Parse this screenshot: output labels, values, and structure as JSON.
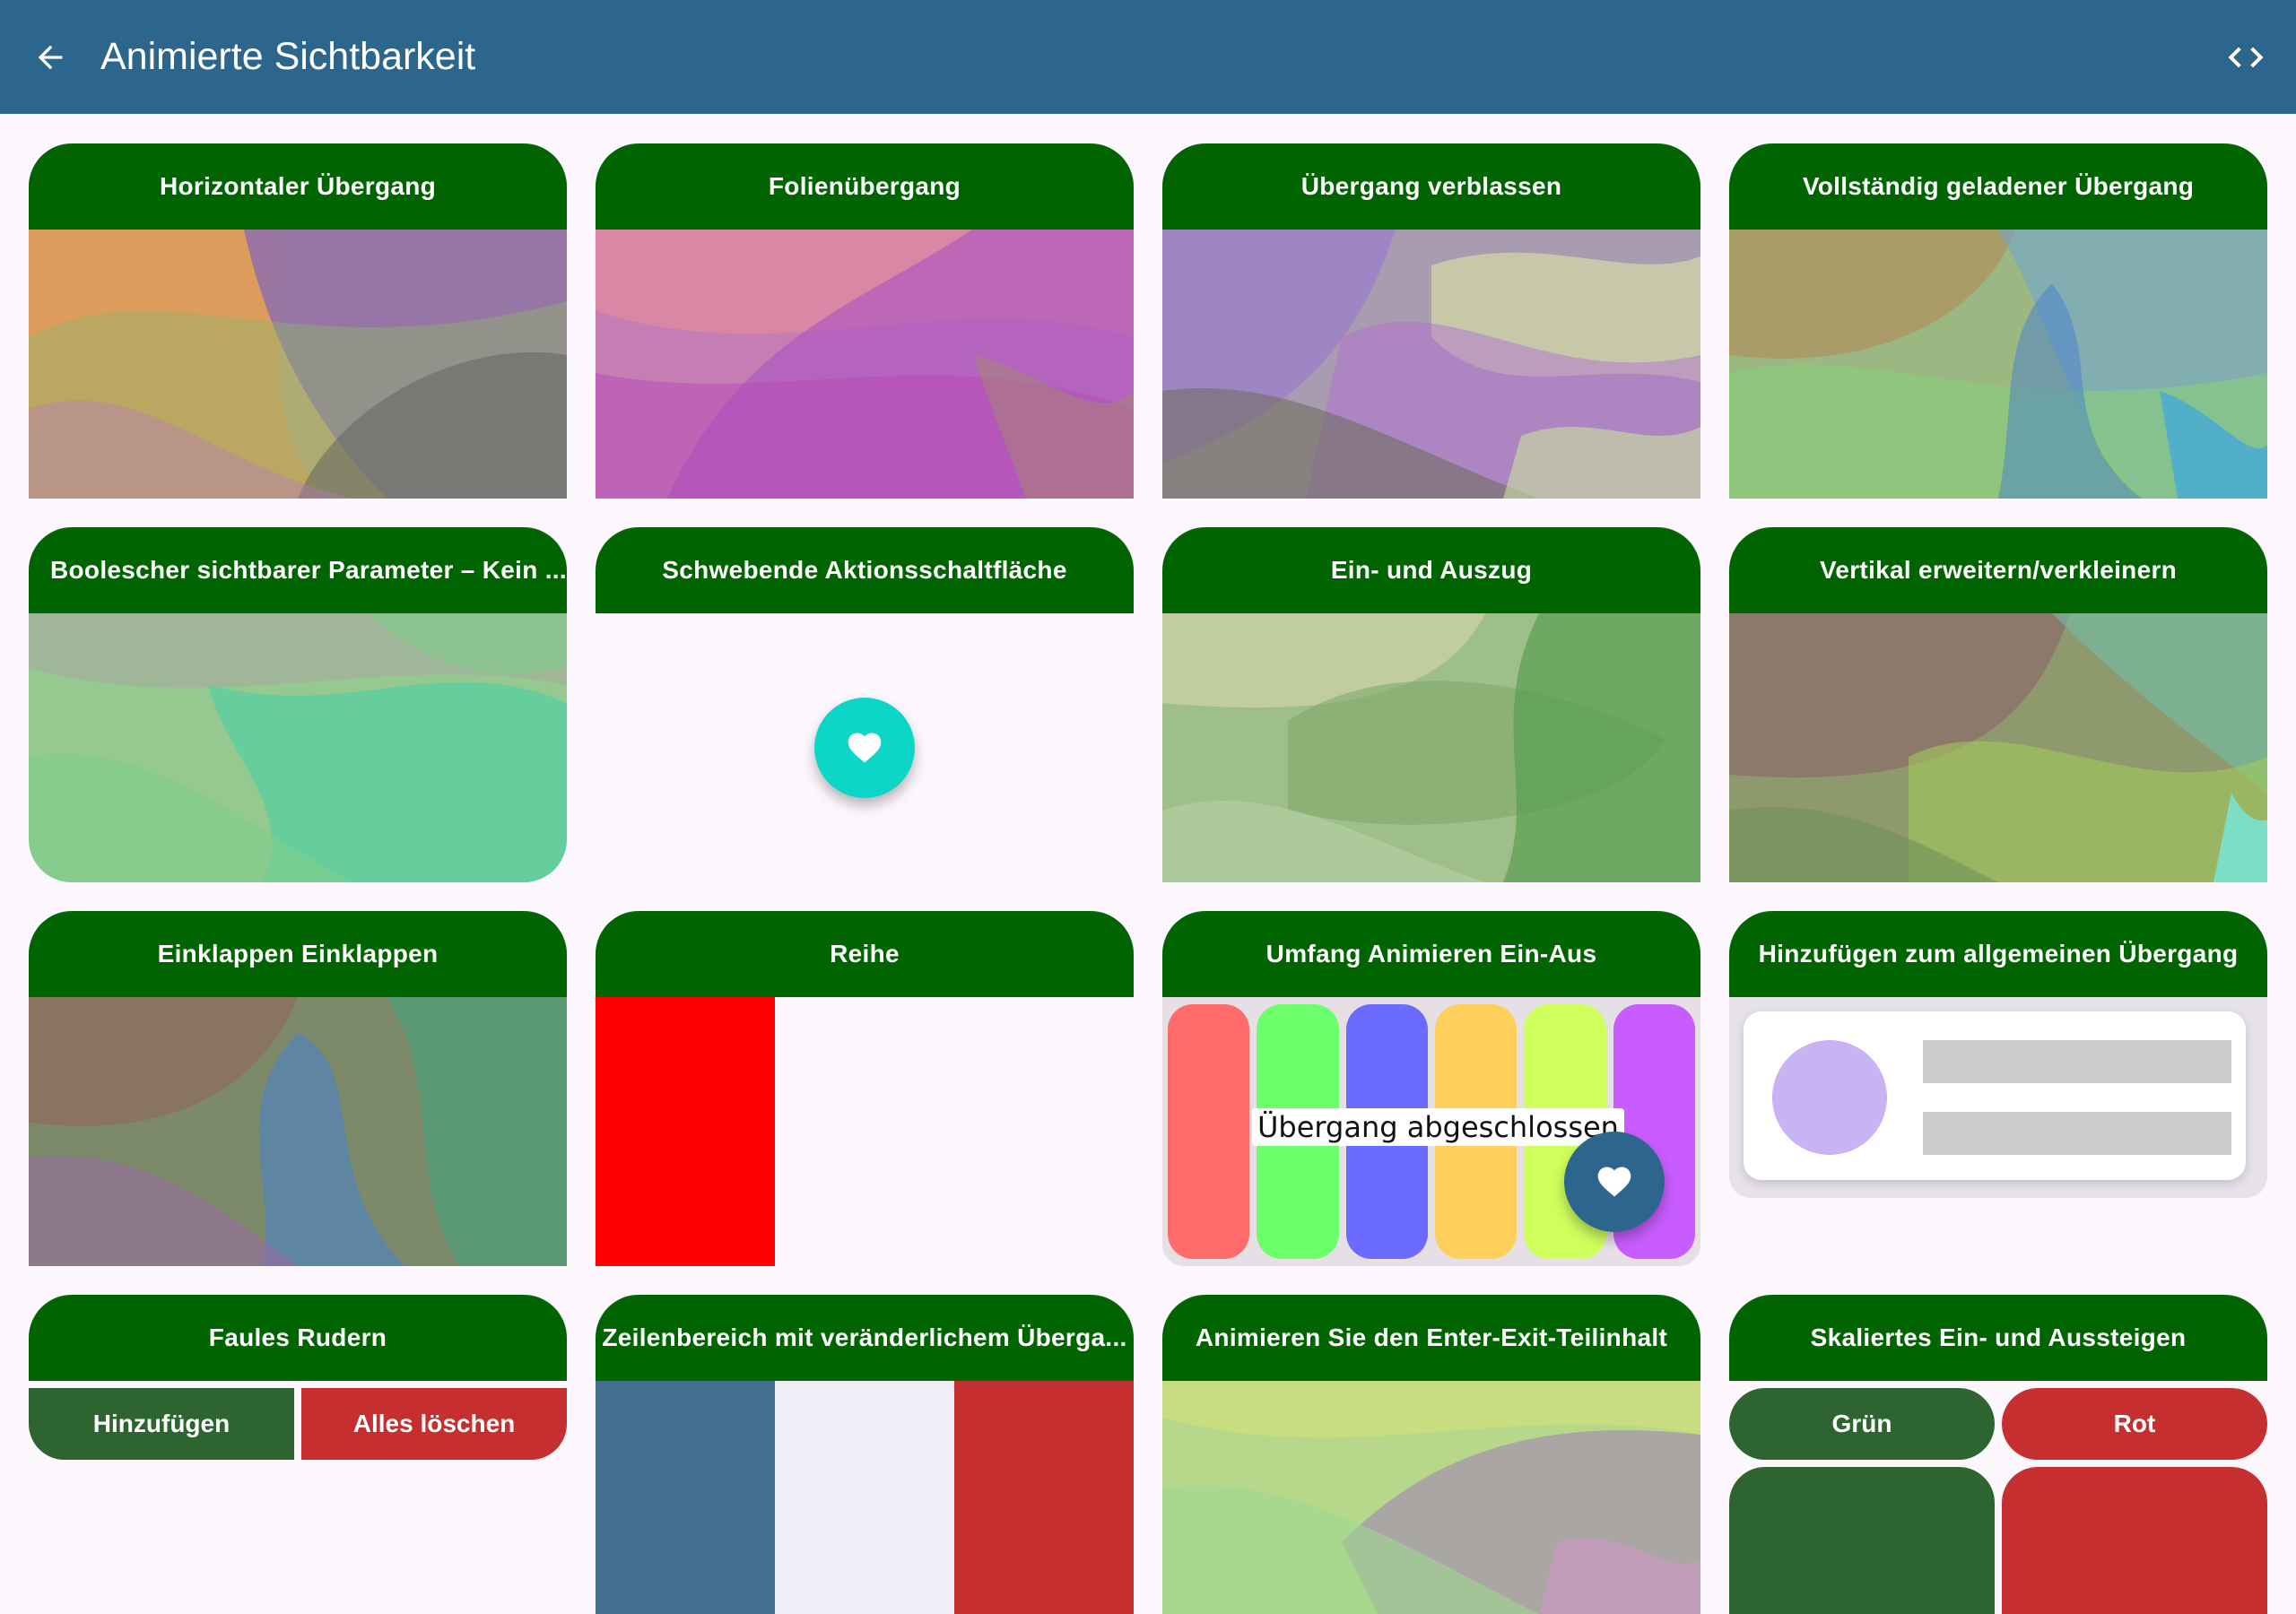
{
  "appbar": {
    "title": "Animierte Sichtbarkeit",
    "back_icon": "arrow-back-icon",
    "code_icon": "code-icon"
  },
  "colors": {
    "appbar": "#2c668c",
    "card_header": "#006400",
    "background": "#fcf7fc",
    "fab_teal": "#0bd6c8",
    "fab_blue": "#2c668c",
    "dark_green": "#2e6430",
    "red": "#c62f2f",
    "pure_red": "#ff0000",
    "flag_blue": "#456e8e",
    "flag_white": "#f1edf6"
  },
  "cards": {
    "c1": {
      "title": "Horizontaler Übergang"
    },
    "c2": {
      "title": "Folienübergang"
    },
    "c3": {
      "title": "Übergang verblassen"
    },
    "c4": {
      "title": "Vollständig geladener Übergang"
    },
    "c5": {
      "title": "Boolescher sichtbarer Parameter – Kein ..."
    },
    "c6": {
      "title": "Schwebende Aktionsschaltfläche",
      "fab_icon": "heart-icon"
    },
    "c7": {
      "title": "Ein- und Auszug"
    },
    "c8": {
      "title": "Vertikal erweitern/verkleinern"
    },
    "c9": {
      "title": "Einklappen Einklappen"
    },
    "c10": {
      "title": "Reihe"
    },
    "c11": {
      "title": "Umfang Animieren Ein-Aus",
      "status": "Übergang abgeschlossen",
      "bar_colors": [
        "#ff6b6b",
        "#6bff6b",
        "#6b6bff",
        "#ffcf5c",
        "#cfff5c",
        "#c95cff"
      ],
      "fab_icon": "heart-icon"
    },
    "c12": {
      "title": "Hinzufügen zum allgemeinen Übergang"
    },
    "c13": {
      "title": "Faules Rudern",
      "add_label": "Hinzufügen",
      "clear_label": "Alles löschen"
    },
    "c14": {
      "title": "Zeilenbereich mit veränderlichem Überga..."
    },
    "c15": {
      "title": "Animieren Sie den Enter-Exit-Teilinhalt"
    },
    "c16": {
      "title": "Skaliertes Ein- und Aussteigen",
      "green_label": "Grün",
      "red_label": "Rot"
    }
  }
}
